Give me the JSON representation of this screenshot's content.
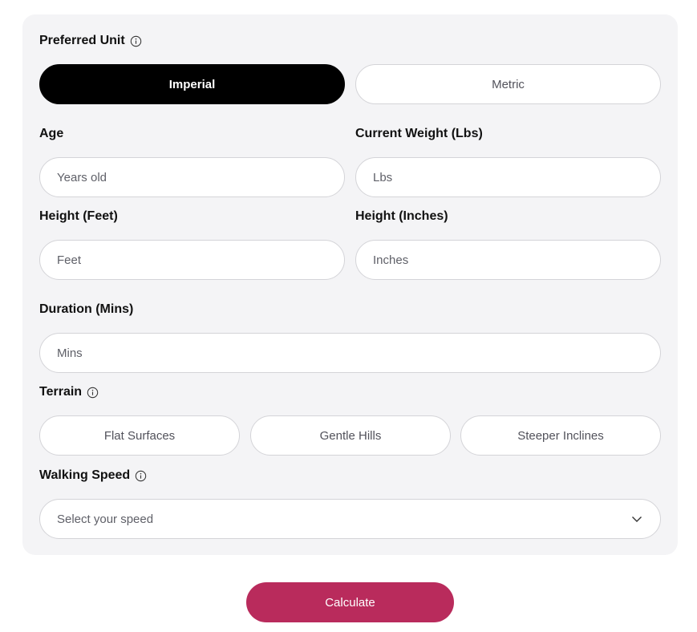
{
  "form": {
    "preferred_unit": {
      "label": "Preferred Unit",
      "options": [
        "Imperial",
        "Metric"
      ],
      "selected": "Imperial"
    },
    "age": {
      "label": "Age",
      "placeholder": "Years old"
    },
    "weight": {
      "label": "Current Weight (Lbs)",
      "placeholder": "Lbs"
    },
    "height_feet": {
      "label": "Height (Feet)",
      "placeholder": "Feet"
    },
    "height_inches": {
      "label": "Height (Inches)",
      "placeholder": "Inches"
    },
    "duration": {
      "label": "Duration (Mins)",
      "placeholder": "Mins"
    },
    "terrain": {
      "label": "Terrain",
      "options": [
        "Flat Surfaces",
        "Gentle Hills",
        "Steeper Inclines"
      ]
    },
    "walking_speed": {
      "label": "Walking Speed",
      "placeholder": "Select your speed"
    }
  },
  "calculate_label": "Calculate",
  "icons": {
    "info": "info-circle-icon",
    "dropdown": "chevron-down-icon"
  },
  "colors": {
    "card_bg": "#f4f4f6",
    "active_pill": "#000000",
    "accent": "#b92b5c"
  }
}
